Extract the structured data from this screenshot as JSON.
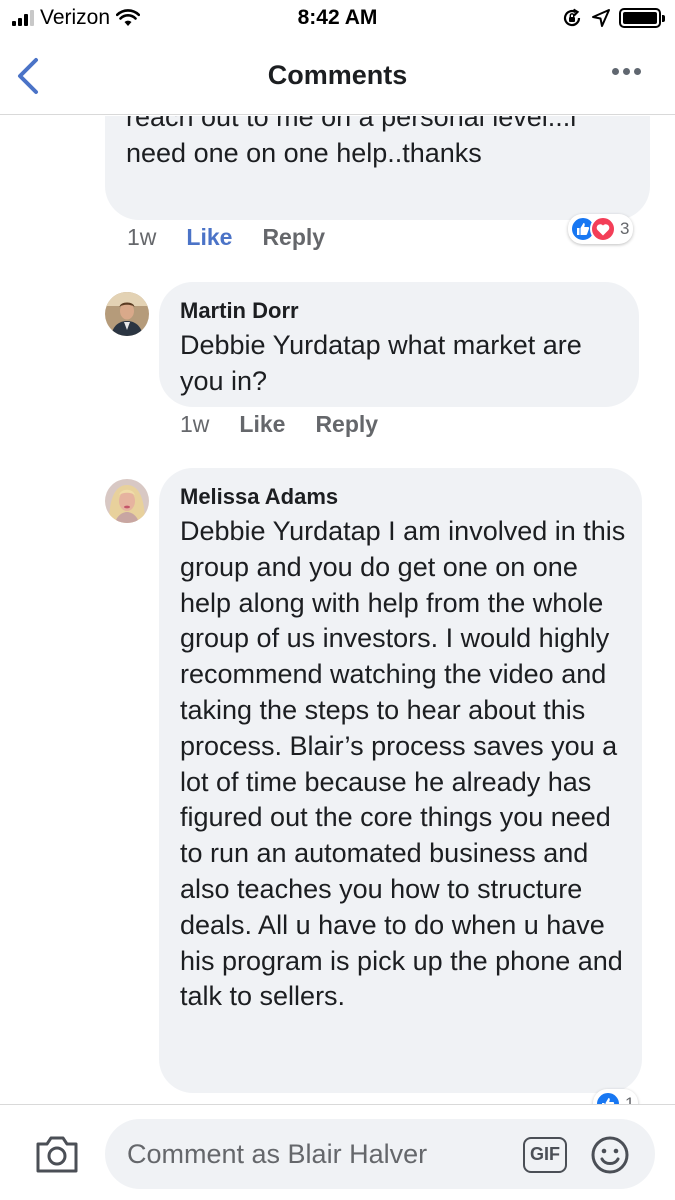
{
  "status_bar": {
    "carrier": "Verizon",
    "time": "8:42 AM"
  },
  "nav": {
    "title": "Comments",
    "icons": {
      "back": "chevron-left-icon",
      "more": "more-horizontal-icon"
    }
  },
  "comments": [
    {
      "author": "",
      "text": "the money coming in ...I wish u could reach out to me on a personal level...i need one on one help..thanks",
      "time": "1w",
      "like_label": "Like",
      "reply_label": "Reply",
      "liked": true,
      "reaction_count": "3"
    },
    {
      "author": "Martin Dorr",
      "text": "Debbie Yurdatap what market are you in?",
      "time": "1w",
      "like_label": "Like",
      "reply_label": "Reply"
    },
    {
      "author": "Melissa Adams",
      "text": "Debbie Yurdatap  I am involved in this group and you do get one on one help along with help from the whole group of us investors. I would highly recommend watching the video and taking the steps to hear about this process. Blair’s process saves you a lot of time because he already has figured out the core things you need to run an automated business and also teaches you how to structure deals. All u have to do when u have his program is pick up the phone and talk to sellers.",
      "reaction_count": "1"
    }
  ],
  "composer": {
    "placeholder": "Comment as Blair Halver",
    "gif_label": "GIF"
  },
  "colors": {
    "link_blue": "#4b73c7",
    "like_blue": "#1877f2",
    "love_red": "#f33e58",
    "bubble_bg": "#f0f2f5",
    "meta_gray": "#65676b"
  }
}
